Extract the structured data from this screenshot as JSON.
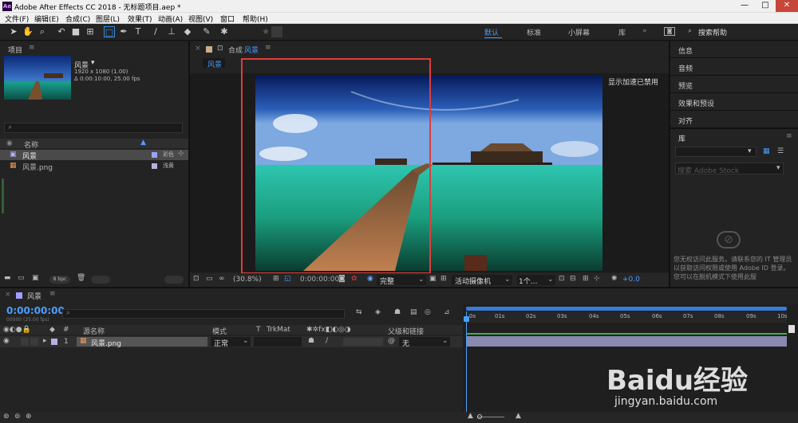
{
  "titlebar": {
    "logo": "Ae",
    "title": "Adobe After Effects CC 2018 - 无标题项目.aep *",
    "minimize": "—",
    "maximize": "□",
    "close": "✕"
  },
  "menu": [
    "文件(F)",
    "编辑(E)",
    "合成(C)",
    "图层(L)",
    "效果(T)",
    "动画(A)",
    "视图(V)",
    "窗口",
    "帮助(H)"
  ],
  "workspaces": {
    "default": "默认",
    "standard": "标准",
    "small": "小屏幕",
    "library": "库",
    "search": "搜索帮助"
  },
  "project": {
    "title": "项目",
    "item_name": "风景",
    "item_info1": "1920 x 1080 (1.00)",
    "item_info2": "Δ 0:00:10:00, 25.00 fps",
    "col_name": "名称",
    "rows": [
      {
        "name": "风景",
        "type": "合成"
      },
      {
        "name": "风景.png",
        "type": "PNG"
      }
    ],
    "row_type_labels": [
      "彩色",
      "浅黄"
    ],
    "bpc": "8 bpc"
  },
  "composition": {
    "tab_prefix": "合成",
    "tab_name": "风景",
    "breadcrumb": "风景",
    "gpu_msg": "显示加速已禁用",
    "zoom": "(30.8%)",
    "timecode": "0:00:00:00",
    "quality": "完整",
    "camera": "活动摄像机",
    "views": "1个...",
    "exposure": "+0.0"
  },
  "right_panel": {
    "items": [
      "信息",
      "音频",
      "预览",
      "效果和预设",
      "对齐"
    ],
    "library": "库",
    "stock_placeholder": "搜索 Adobe Stock",
    "offline_msg": "您无权访问此服务。请联系您的 IT 管理员以获取访问权限或使用 Adobe ID 登录。您可以在脱机模式下使用此服"
  },
  "timeline": {
    "tab": "风景",
    "timecode": "0:00:00:00",
    "frames": "00000 (25.00 fps)",
    "col_src": "源名称",
    "col_mode": "模式",
    "col_t": "T",
    "col_trk": "TrkMat",
    "col_parent": "父级和链接",
    "layer_num": "1",
    "layer_name": "风景.png",
    "layer_mode": "正常",
    "layer_parent": "无",
    "ticks": [
      "0s",
      "01s",
      "02s",
      "03s",
      "04s",
      "05s",
      "06s",
      "07s",
      "08s",
      "09s",
      "10s"
    ]
  },
  "watermark": {
    "brand": "Baidu经验",
    "url": "jingyan.baidu.com"
  }
}
